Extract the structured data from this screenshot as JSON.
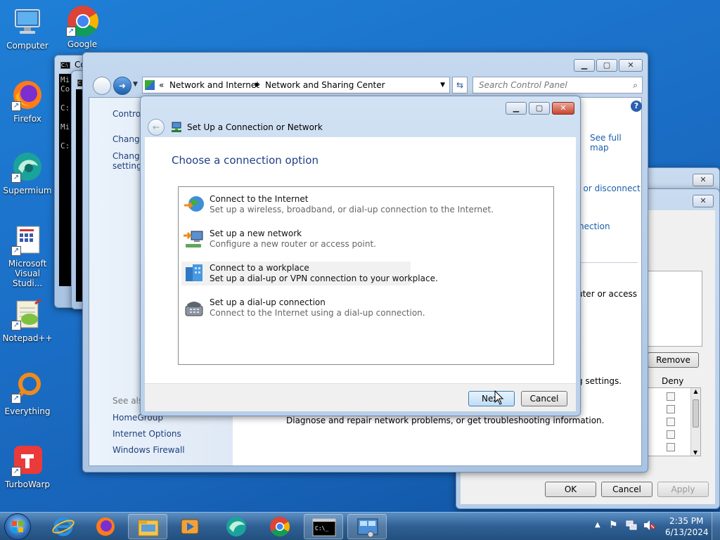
{
  "desktop": {
    "icons": [
      {
        "label": "Computer"
      },
      {
        "label": "Google"
      },
      {
        "label": "Firefox"
      },
      {
        "label": "Supermium"
      },
      {
        "label": "Microsoft Visual Studi..."
      },
      {
        "label": "Notepad++"
      },
      {
        "label": "Everything"
      },
      {
        "label": "TurboWarp"
      }
    ]
  },
  "console_back": {
    "title": "Co",
    "lines": [
      "Mi",
      "Co",
      "C:",
      "Mi",
      "C:"
    ]
  },
  "explorer": {
    "breadcrumb_prefix": "«",
    "breadcrumb": [
      "Network and Internet",
      "Network and Sharing Center"
    ],
    "search_placeholder": "Search Control Panel",
    "left_panel": {
      "control_label": "Control",
      "change1": "Change",
      "change2": "Change",
      "settings": "settings",
      "see_also": "See also",
      "links": [
        "HomeGroup",
        "Internet Options",
        "Windows Firewall"
      ]
    },
    "right": {
      "see_full_map": "See full map",
      "or_disconnect": "t or disconnect",
      "nection": "nection",
      "uter_or_access": "uter or access",
      "g_settings": "g settings.",
      "diagnose": "Diagnose and repair network problems, or get troubleshooting information."
    }
  },
  "props_window": {
    "remove_label": "Remove",
    "deny_label": "Deny",
    "ok_label": "OK",
    "cancel_label": "Cancel",
    "apply_label": "Apply"
  },
  "dialog": {
    "title": "Set Up a Connection or Network",
    "heading": "Choose a connection option",
    "options": [
      {
        "title": "Connect to the Internet",
        "desc": "Set up a wireless, broadband, or dial-up connection to the Internet."
      },
      {
        "title": "Set up a new network",
        "desc": "Configure a new router or access point."
      },
      {
        "title": "Connect to a workplace",
        "desc": "Set up a dial-up or VPN connection to your workplace."
      },
      {
        "title": "Set up a dial-up connection",
        "desc": "Connect to the Internet using a dial-up connection."
      }
    ],
    "next_label": "Next",
    "cancel_label": "Cancel"
  },
  "taskbar": {
    "time": "2:35 PM",
    "date": "6/13/2024"
  }
}
